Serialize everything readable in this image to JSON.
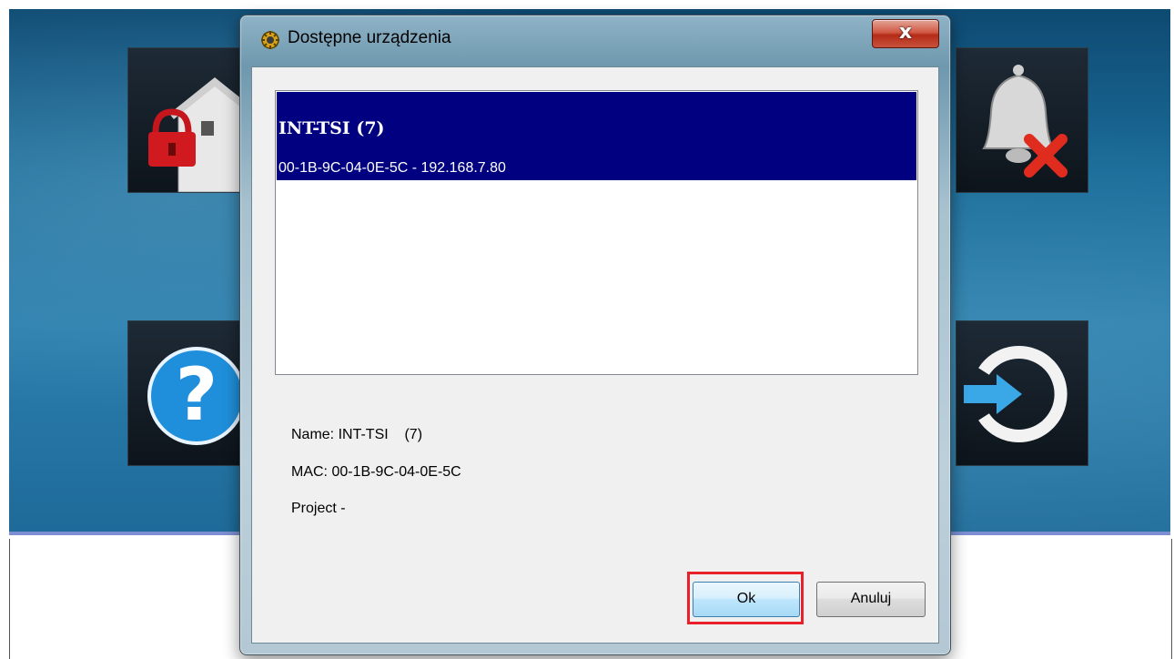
{
  "dialog": {
    "title": "Dostępne urządzenia",
    "close_label": "x",
    "devices": [
      {
        "name": "INT-TSI (7)",
        "address": "00-1B-9C-04-0E-5C - 192.168.7.80"
      }
    ],
    "info": {
      "name_line": "Name: INT-TSI    (7)",
      "mac_line": "MAC: 00-1B-9C-04-0E-5C",
      "project_line": "Project -"
    },
    "ok_label": "Ok",
    "cancel_label": "Anuluj"
  },
  "background_app": {
    "tiles": [
      {
        "icon": "house-lock-icon"
      },
      {
        "icon": "help-icon"
      },
      {
        "icon": "bell-cancel-icon"
      },
      {
        "icon": "logout-icon"
      }
    ]
  },
  "colors": {
    "selection": "#000080",
    "highlight_frame": "#e8202a",
    "app_background": "#1a6b98"
  }
}
